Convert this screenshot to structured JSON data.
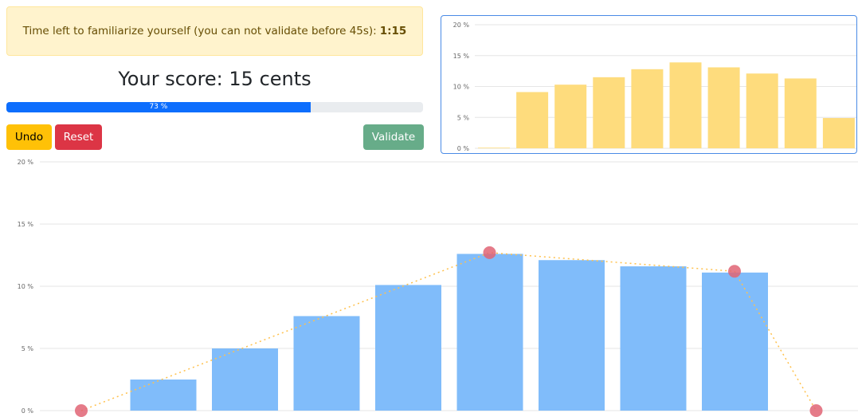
{
  "timer": {
    "text": "Time left to familiarize yourself (you can not validate before 45s):",
    "value": "1:15"
  },
  "score": {
    "text": "Your score: 15 cents"
  },
  "progress": {
    "percent": 73,
    "label": "73 %"
  },
  "buttons": {
    "undo": "Undo",
    "reset": "Reset",
    "validate": "Validate"
  },
  "colors": {
    "reference_bars": "#fedc7d",
    "main_bars": "#80bcfa",
    "points": "#e06474",
    "dotted_line": "#ffc14d"
  },
  "chart_data": [
    {
      "type": "bar",
      "name": "reference",
      "y_ticks": [
        "0 %",
        "5 %",
        "10 %",
        "15 %",
        "20 %"
      ],
      "ylim": [
        0,
        20
      ],
      "grid": true,
      "values": [
        0.1,
        9.1,
        10.3,
        11.5,
        12.8,
        13.9,
        13.1,
        12.1,
        11.3,
        4.9
      ]
    },
    {
      "type": "bar",
      "name": "main",
      "y_ticks": [
        "0 %",
        "5 %",
        "10 %",
        "15 %",
        "20 %"
      ],
      "ylim": [
        0,
        20
      ],
      "grid": true,
      "values": [
        2.5,
        5.0,
        7.6,
        10.1,
        12.6,
        12.1,
        11.6,
        11.1
      ],
      "points": [
        {
          "index": 0,
          "value": 0
        },
        {
          "index": 5,
          "value": 12.7
        },
        {
          "index": 8,
          "value": 11.2
        },
        {
          "index": 9,
          "value": 0
        }
      ]
    }
  ]
}
